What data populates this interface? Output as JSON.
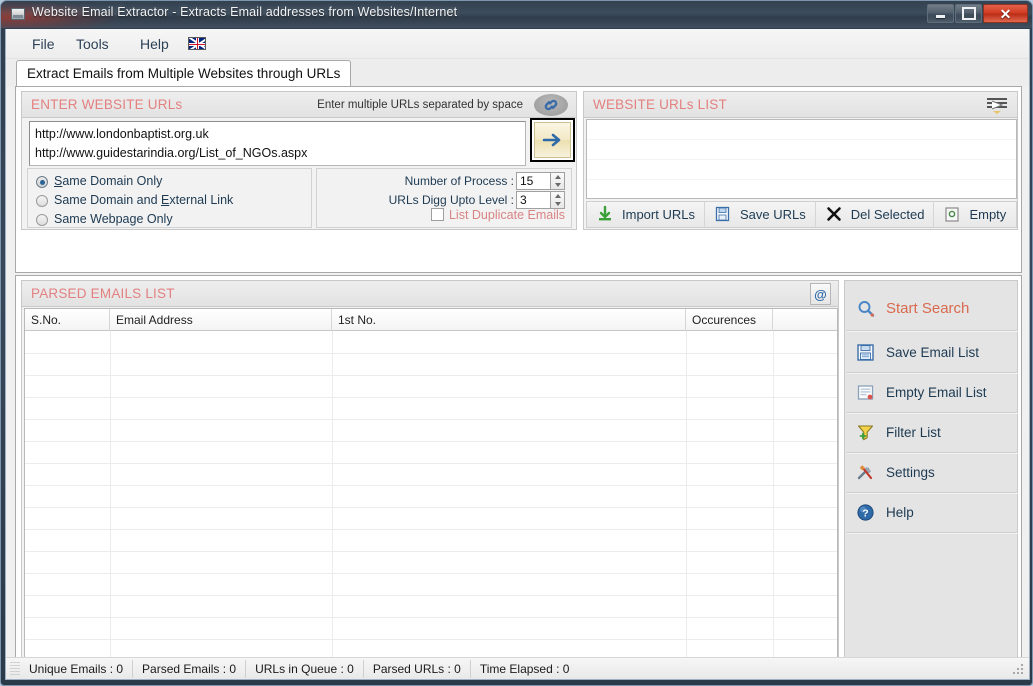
{
  "window": {
    "title": "Website Email Extractor - Extracts Email addresses from Websites/Internet",
    "app_icon": "application-icon",
    "minimize_label": "",
    "maximize_label": "",
    "close_label": "✕"
  },
  "menu": {
    "items": [
      {
        "label": "File",
        "name": "menu-file"
      },
      {
        "label": "Tools",
        "name": "menu-tools"
      },
      {
        "label": "Help",
        "name": "menu-help"
      }
    ],
    "flag_icon": "uk-flag-icon"
  },
  "tabs": [
    {
      "label": "Extract Emails from Multiple Websites through URLs",
      "active": true
    }
  ],
  "enter_urls": {
    "title": "ENTER WEBSITE URLs",
    "hint": "Enter multiple URLs separated by space",
    "link_icon": "chain-link-icon",
    "url_line_1": "http://www.londonbaptist.org.uk",
    "url_line_2": "http://www.guidestarindia.org/List_of_NGOs.aspx",
    "go_button_icon": "arrow-right-icon",
    "options": [
      {
        "label_before": "",
        "accel": "S",
        "label_after": "ame Domain Only",
        "full": "Same Domain Only",
        "selected": true
      },
      {
        "label_before": "Same Domain and ",
        "accel": "E",
        "label_after": "xternal Link",
        "full": "Same Domain and External Link",
        "selected": false
      },
      {
        "label_before": "",
        "accel": "",
        "label_after": "Same Webpage Only",
        "full": "Same Webpage Only",
        "selected": false
      }
    ],
    "spinners": [
      {
        "label": "Number of Process :",
        "value": "15"
      },
      {
        "label": "URLs Digg Upto Level :",
        "value": "3"
      }
    ],
    "duplicate_checkbox": {
      "label": "List Duplicate Emails",
      "checked": false
    }
  },
  "urls_list": {
    "title": "WEBSITE URLs LIST",
    "header_icon": "list-stack-icon",
    "items": [],
    "actions": [
      {
        "label": "Import URLs",
        "icon": "import-down-arrow-icon"
      },
      {
        "label": "Save URLs",
        "icon": "save-disk-icon"
      },
      {
        "label": "Del Selected",
        "icon": "delete-x-icon"
      },
      {
        "label": "Empty",
        "icon": "empty-box-icon"
      }
    ]
  },
  "parsed_emails": {
    "title": "PARSED EMAILS LIST",
    "header_icon": "at-sign-icon",
    "columns": [
      "S.No.",
      "Email Address",
      "1st No.",
      "Occurences",
      ""
    ],
    "rows": []
  },
  "sidebar": {
    "buttons": [
      {
        "label": "Start Search",
        "icon": "search-magnifier-icon",
        "accent": "#d96a4e"
      },
      {
        "label": "Save Email List",
        "icon": "save-disk-icon"
      },
      {
        "label": "Empty Email List",
        "icon": "empty-list-icon"
      },
      {
        "label": "Filter List",
        "icon": "funnel-filter-icon"
      },
      {
        "label": "Settings",
        "icon": "tools-wrench-icon"
      },
      {
        "label": "Help",
        "icon": "help-question-icon"
      }
    ]
  },
  "statusbar": {
    "cells": [
      "Unique Emails :  0",
      "Parsed Emails :  0",
      "URLs in Queue :  0",
      "Parsed URLs :  0",
      "Time Elapsed :  0"
    ]
  },
  "colors": {
    "panel_title": "#e38080",
    "accent_red": "#d96a4e",
    "label_blue": "#1d3a52",
    "close_red": "#cf3b22"
  }
}
